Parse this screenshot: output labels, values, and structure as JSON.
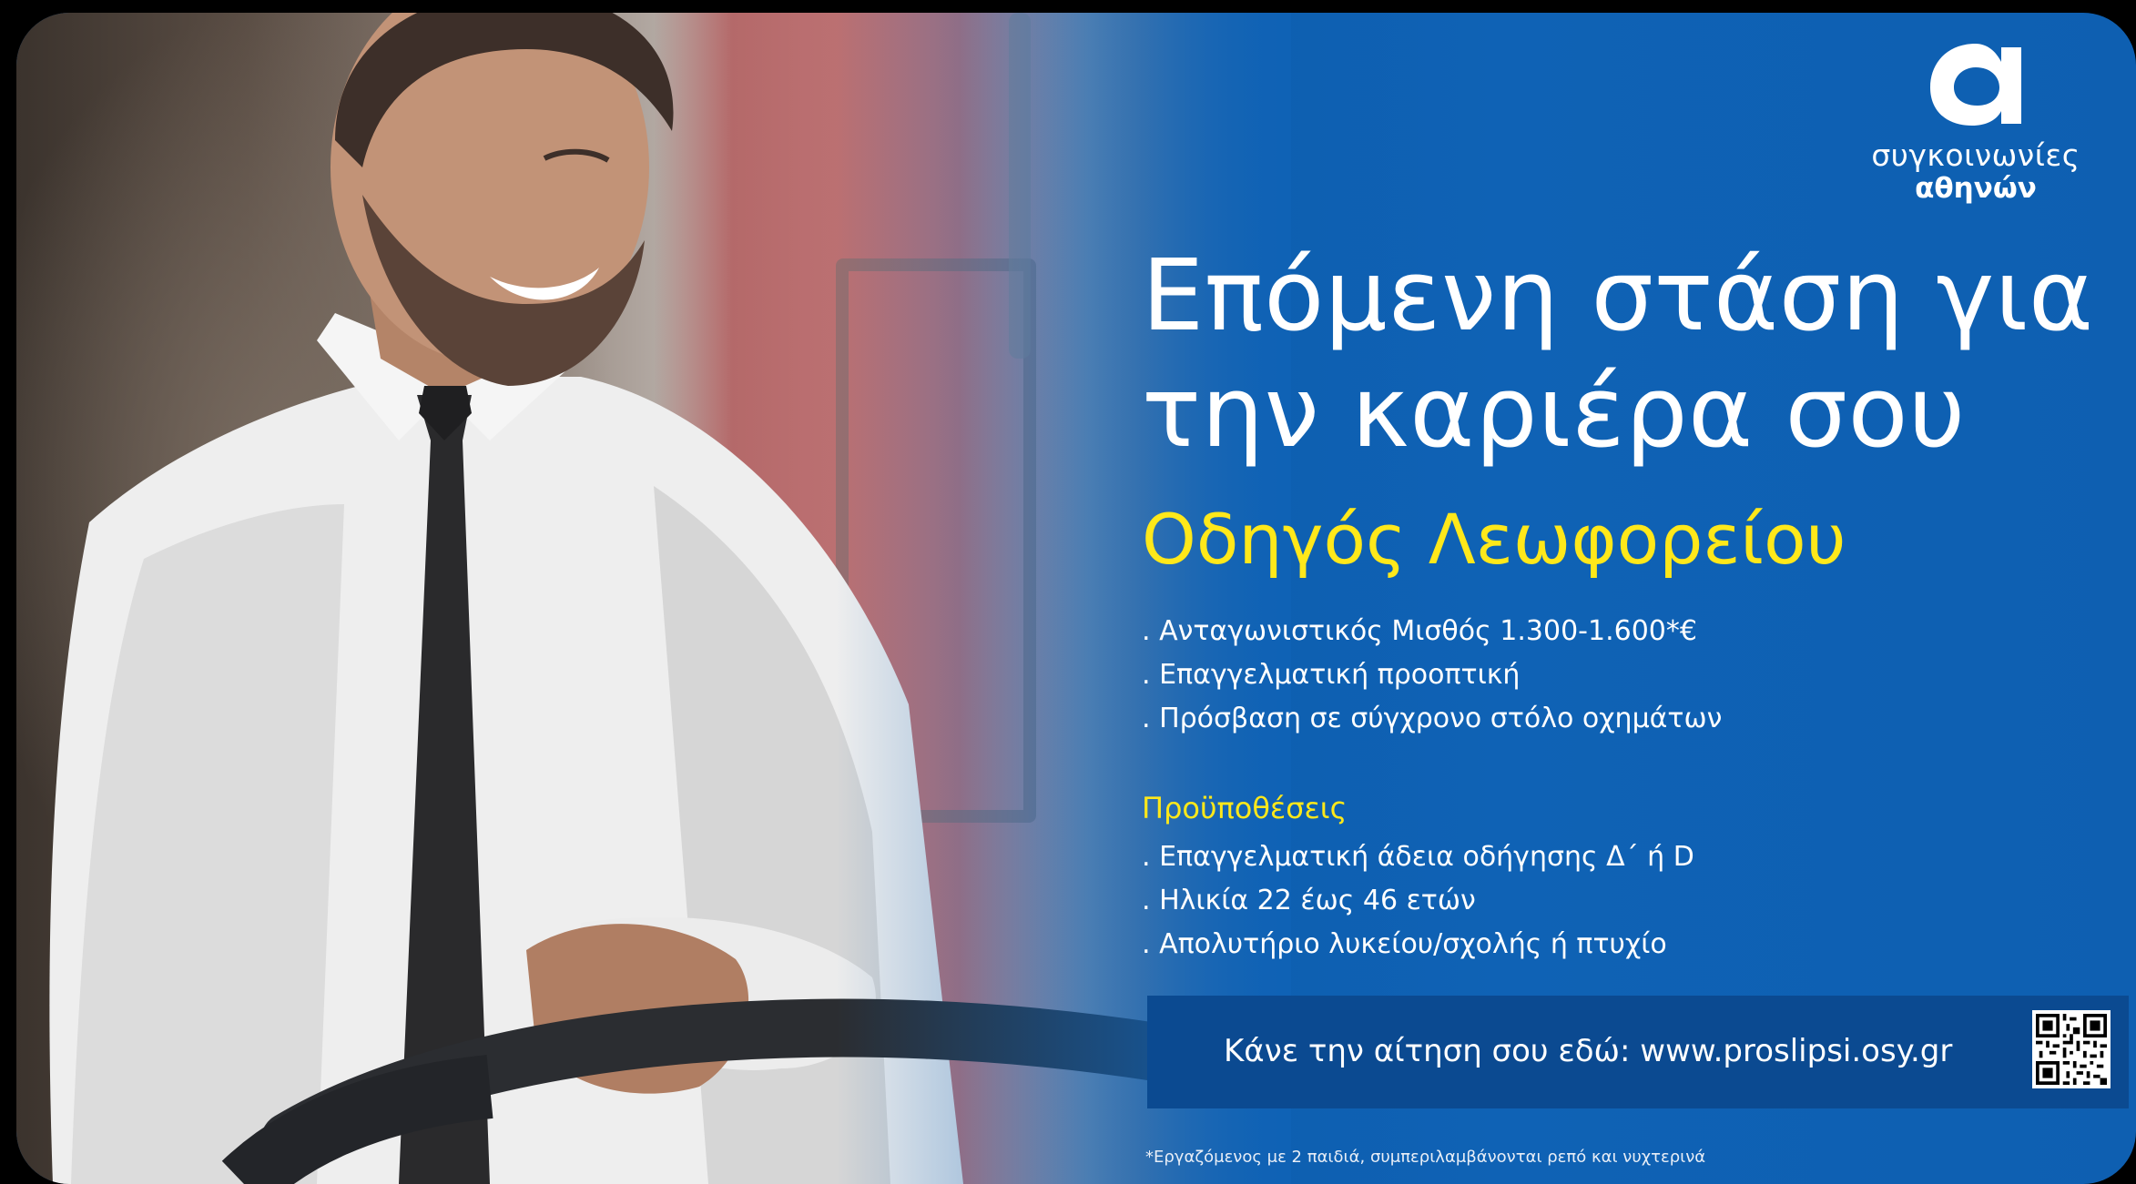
{
  "logo": {
    "line1": "συγκοινωνίες",
    "line2": "αθηνών",
    "icon": "alpha-logo-icon"
  },
  "headline": {
    "line1": "Επόμενη στάση για",
    "line2": "την καριέρα σου"
  },
  "subhead": "Οδηγός Λεωφορείου",
  "benefits": [
    "Ανταγωνιστικός Μισθός 1.300-1.600*€",
    "Επαγγελματική προοπτική",
    "Πρόσβαση σε σύγχρονο στόλο οχημάτων"
  ],
  "requirements": {
    "title": "Προϋποθέσεις",
    "items": [
      "Επαγγελματική άδεια οδήγησης Δ΄ ή D",
      "Ηλικία 22 έως 46 ετών",
      "Απολυτήριο λυκείου/σχολής ή πτυχίο"
    ]
  },
  "cta": {
    "text": "Κάνε την αίτηση σου εδώ: www.proslipsi.osy.gr",
    "qr_icon": "qr-code-icon"
  },
  "footnote": "*Εργαζόμενος με 2 παιδιά, συμπεριλαμβάνονται ρεπό και νυχτερινά",
  "colors": {
    "brand_blue": "#0f62b5",
    "cta_blue": "#0b4a91",
    "accent_yellow": "#ffe81a",
    "text_white": "#ffffff"
  }
}
